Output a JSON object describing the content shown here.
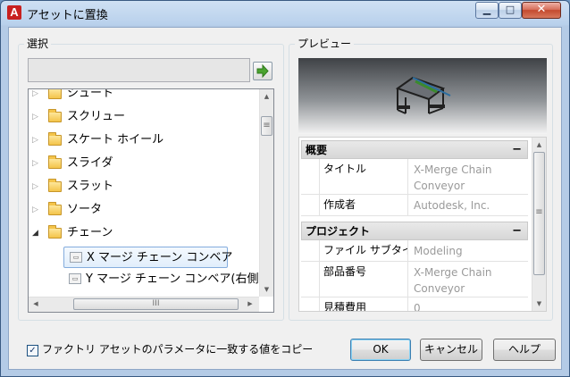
{
  "window": {
    "title": "アセットに置換",
    "app_icon_letter": "A",
    "controls": {
      "minimize": "▁",
      "maximize": "□",
      "close": "✕"
    }
  },
  "selection_group": {
    "label": "選択",
    "search_value": "",
    "go_icon": "right-arrow-icon",
    "tree": [
      {
        "label": "シュート",
        "expander": "▷"
      },
      {
        "label": "スクリュー",
        "expander": "▷"
      },
      {
        "label": "スケート ホイール",
        "expander": "▷"
      },
      {
        "label": "スライダ",
        "expander": "▷"
      },
      {
        "label": "スラット",
        "expander": "▷"
      },
      {
        "label": "ソータ",
        "expander": "▷"
      },
      {
        "label": "チェーン",
        "expander": "◢"
      }
    ],
    "items": [
      {
        "label": "X マージ チェーン コンベア",
        "selected": true
      },
      {
        "label": "Y マージ チェーン コンベア(右側)",
        "selected": false
      }
    ],
    "scroll_grip": "≡",
    "hscroll_grip": "III",
    "arrows": {
      "up": "▲",
      "down": "▼",
      "left": "◀",
      "right": "▶"
    }
  },
  "preview_group": {
    "label": "プレビュー",
    "sections": [
      {
        "title": "概要",
        "collapse": "−",
        "rows": [
          {
            "name": "タイトル",
            "value": "X-Merge Chain Conveyor"
          },
          {
            "name": "作成者",
            "value": "Autodesk, Inc."
          }
        ]
      },
      {
        "title": "プロジェクト",
        "collapse": "−",
        "rows": [
          {
            "name": "ファイル サブタイプ",
            "value": "Modeling"
          },
          {
            "name": "部品番号",
            "value": "X-Merge Chain Conveyor"
          },
          {
            "name": "見積費用",
            "value": "0"
          }
        ]
      }
    ]
  },
  "footer": {
    "checkbox_checked": true,
    "checkbox_mark": "✓",
    "checkbox_label": "ファクトリ アセットのパラメータに一致する値をコピー",
    "ok": "OK",
    "cancel": "キャンセル",
    "help": "ヘルプ"
  }
}
